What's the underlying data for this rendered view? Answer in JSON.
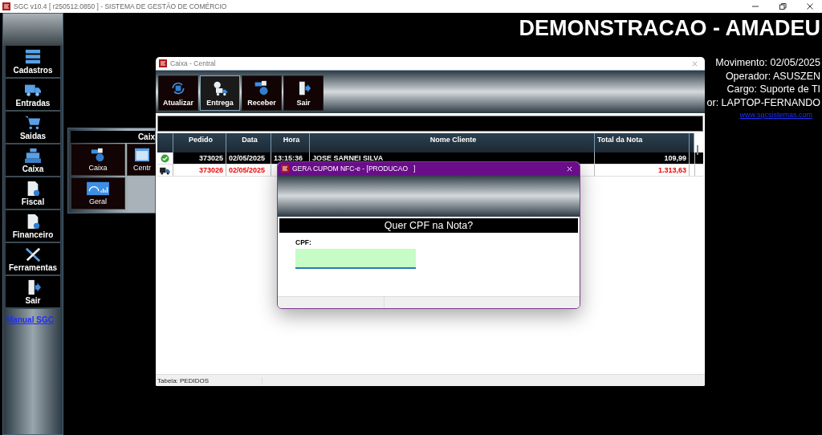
{
  "app_title_bar": {
    "title": "SGC v10.4 [ r250512.0850 ] - SISTEMA DE GESTÃO DE COMÉRCIO"
  },
  "sidebar": {
    "items": [
      {
        "label": "Cadastros"
      },
      {
        "label": "Entradas"
      },
      {
        "label": "Saidas"
      },
      {
        "label": "Caixa"
      },
      {
        "label": "Fiscal"
      },
      {
        "label": "Financeiro"
      },
      {
        "label": "Ferramentas"
      },
      {
        "label": "Sair"
      }
    ],
    "manual_link": "Manual SGC"
  },
  "company_header": "DEMONSTRACAO - AMADEU",
  "session_info": [
    "Movimento: 02/05/2025",
    "Operador: ASUSZEN",
    "Cargo: Suporte de TI",
    "or: LAPTOP-FERNANDO"
  ],
  "website_link": "www.sgcsistemas.com",
  "submenu": {
    "title": "Caix",
    "items": [
      {
        "label": "Caixa"
      },
      {
        "label": "Centr"
      },
      {
        "label": "Geral"
      }
    ]
  },
  "cash_window": {
    "title": "Caixa - Central",
    "toolbar": [
      {
        "label": "Atualizar",
        "selected": false
      },
      {
        "label": "Entrega",
        "selected": true
      },
      {
        "label": "Receber",
        "selected": false
      },
      {
        "label": "Sair",
        "selected": false
      }
    ],
    "table": {
      "columns": [
        "Pedido",
        "Data",
        "Hora",
        "Nome Cliente",
        "Total da Nota"
      ],
      "rows": [
        {
          "kind": "paid",
          "selected": true,
          "pedido": "373025",
          "data": "02/05/2025",
          "hora": "13:15:36",
          "cliente": "JOSE SARNEI SILVA",
          "total": "109,99"
        },
        {
          "kind": "delivery",
          "selected": false,
          "pedido": "373026",
          "data": "02/05/2025",
          "total": "1.313,63"
        }
      ]
    },
    "status_bar": "Tabela: PEDIDOS"
  },
  "dialog": {
    "title": "GERA CUPOM NFC-e - [PRODUCAO   ]",
    "question": "Quer CPF na Nota?",
    "cpf_label": "CPF:"
  }
}
